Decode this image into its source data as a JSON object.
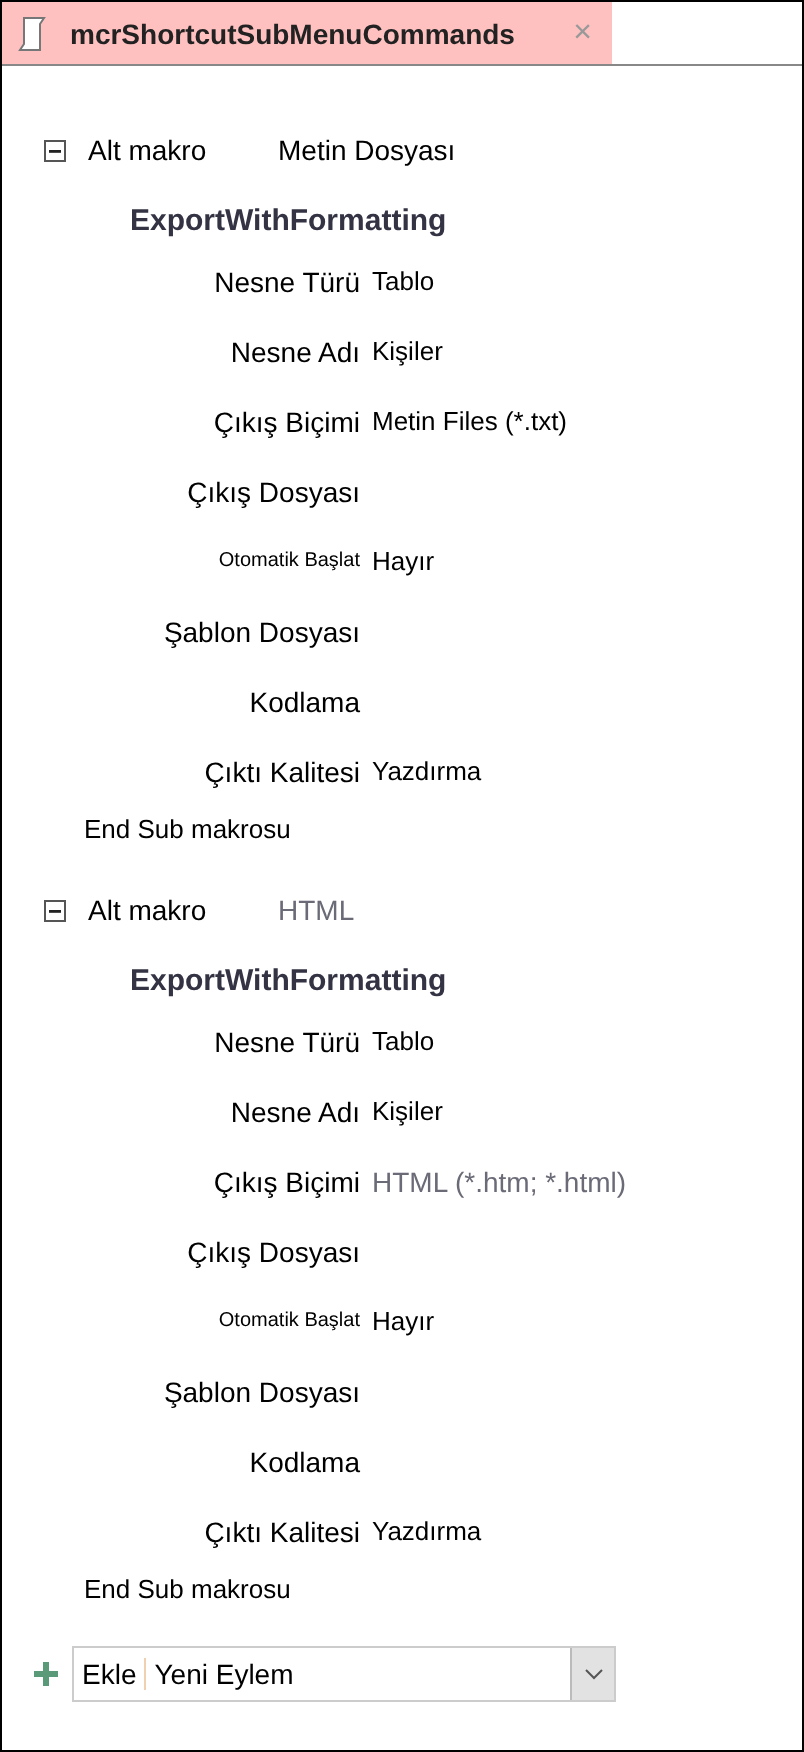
{
  "tab": {
    "title": "mcrShortcutSubMenuCommands",
    "close": "×",
    "selected": true
  },
  "submacros": [
    {
      "label": "Alt makro",
      "name": "Metin Dosyası",
      "name_greyed": false,
      "expanded": true,
      "action": "ExportWithFormatting",
      "args": [
        {
          "label": "Nesne Türü",
          "value": "Tablo",
          "kind": "normal",
          "greyed": false
        },
        {
          "label": "Nesne Adı",
          "value": "Kişiler",
          "kind": "normal",
          "greyed": false
        },
        {
          "label": "Çıkış Biçimi",
          "value": "Metin Files (*.txt)",
          "kind": "normal",
          "greyed": false
        },
        {
          "label": "Çıkış Dosyası",
          "kind": "normal"
        },
        {
          "label": "Otomatik Başlat",
          "value": "Hayır",
          "kind": "compact",
          "greyed": false
        },
        {
          "label": "Şablon Dosyası",
          "kind": "normal"
        },
        {
          "label": "Kodlama",
          "kind": "normal"
        },
        {
          "label": "Çıktı Kalitesi",
          "value": "Yazdırma",
          "kind": "normal",
          "greyed": false
        }
      ],
      "end": "End Sub makrosu"
    },
    {
      "label": "Alt makro",
      "name": "HTML",
      "name_greyed": true,
      "expanded": true,
      "action": "ExportWithFormatting",
      "args": [
        {
          "label": "Nesne Türü",
          "value": "Tablo",
          "kind": "normal",
          "greyed": false
        },
        {
          "label": "Nesne Adı",
          "value": "Kişiler",
          "kind": "normal",
          "greyed": false
        },
        {
          "label": "Çıkış Biçimi",
          "value": "HTML (*.htm; *.html)",
          "kind": "normal",
          "greyed": true
        },
        {
          "label": "Çıkış Dosyası",
          "kind": "normal"
        },
        {
          "label": "Otomatik Başlat",
          "value": "Hayır",
          "kind": "compact",
          "greyed": false
        },
        {
          "label": "Şablon Dosyası",
          "kind": "normal"
        },
        {
          "label": "Kodlama",
          "kind": "normal"
        },
        {
          "label": "Çıktı Kalitesi",
          "value": "Yazdırma",
          "kind": "normal",
          "greyed": false
        }
      ],
      "end": "End Sub makrosu"
    }
  ],
  "add_action": {
    "label": "Ekle",
    "value": "Yeni Eylem"
  }
}
